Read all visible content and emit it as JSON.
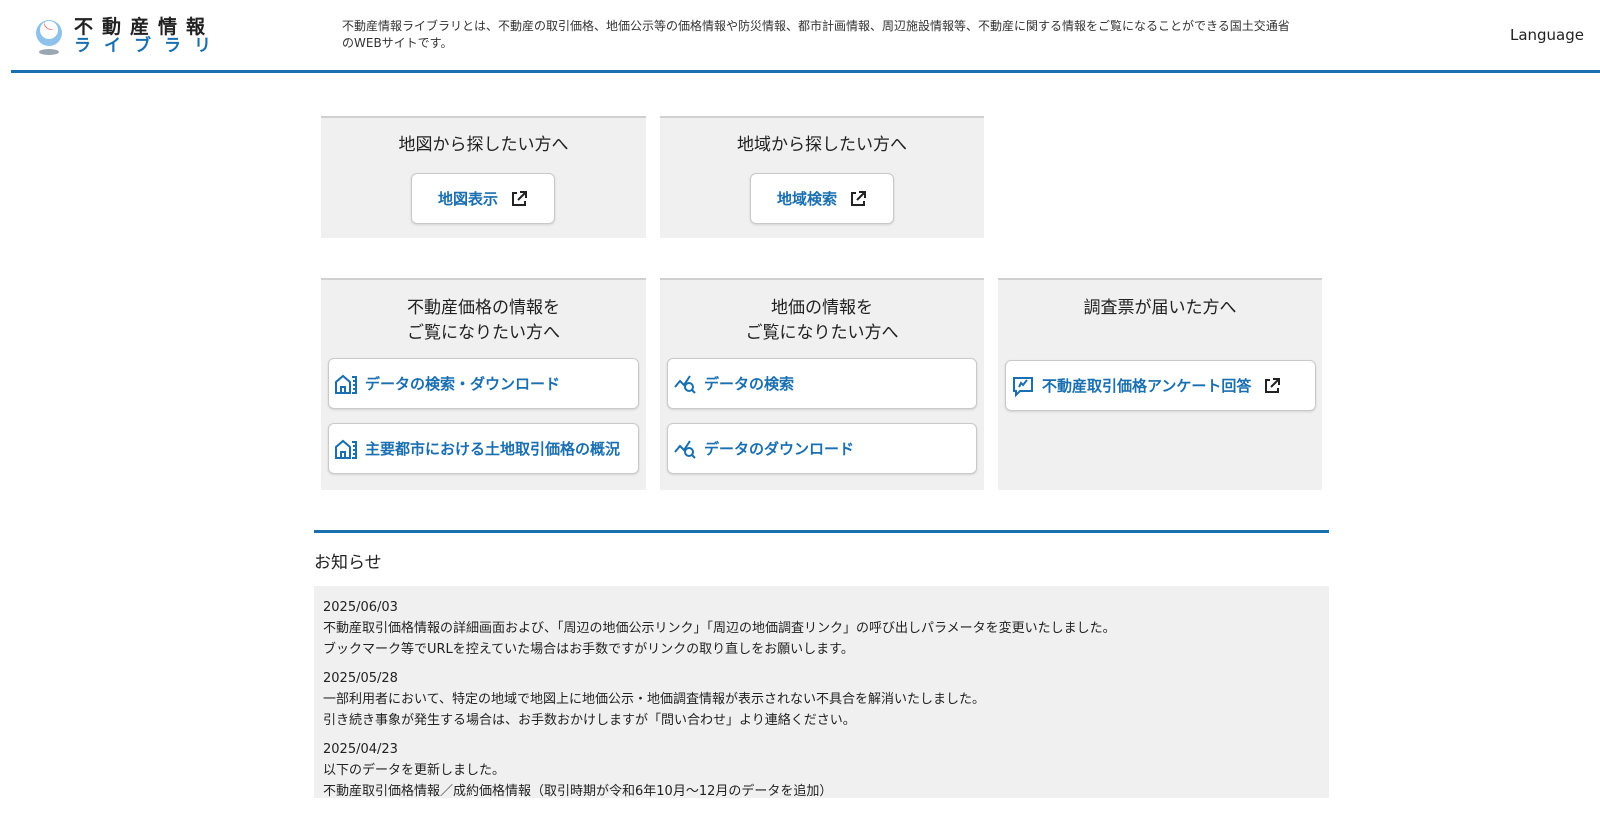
{
  "header": {
    "logo": {
      "line1": "不動産情報",
      "line2": "ライブラリ"
    },
    "tagline": "不動産情報ライブラリとは、不動産の取引価格、地価公示等の価格情報や防災情報、都市計画情報、周辺施設情報等、不動産に関する情報をご覧になることができる国土交通省のWEBサイトです。",
    "language_label": "Language"
  },
  "search_map": {
    "title": "地図から探したい方へ",
    "button_label": "地図表示"
  },
  "search_region": {
    "title": "地域から探したい方へ",
    "button_label": "地域検索"
  },
  "real_estate_prices": {
    "title_line1": "不動産価格の情報を",
    "title_line2": "ご覧になりたい方へ",
    "buttons": [
      "データの検索・ダウンロード",
      "主要都市における土地取引価格の概況"
    ]
  },
  "land_prices": {
    "title_line1": "地価の情報を",
    "title_line2": "ご覧になりたい方へ",
    "buttons": [
      "データの検索",
      "データのダウンロード"
    ]
  },
  "survey": {
    "title": "調査票が届いた方へ",
    "button_label": "不動産取引価格アンケート回答"
  },
  "news": {
    "title": "お知らせ",
    "items": [
      {
        "date": "2025/06/03",
        "lines": [
          "不動産取引価格情報の詳細画面および、「周辺の地価公示リンク」「周辺の地価調査リンク」の呼び出しパラメータを変更いたしました。",
          "ブックマーク等でURLを控えていた場合はお手数ですがリンクの取り直しをお願いします。"
        ]
      },
      {
        "date": "2025/05/28",
        "lines": [
          "一部利用者において、特定の地域で地図上に地価公示・地価調査情報が表示されない不具合を解消いたしました。",
          "引き続き事象が発生する場合は、お手数おかけしますが「問い合わせ」より連絡ください。"
        ]
      },
      {
        "date": "2025/04/23",
        "lines": [
          "以下のデータを更新しました。",
          "不動産取引価格情報／成約価格情報（取引時期が令和6年10月～12月のデータを追加）"
        ]
      }
    ]
  },
  "colors": {
    "accent": "#1a6fb0",
    "panel_bg": "#f0f0f0",
    "logo_red": "#e03a3a"
  }
}
